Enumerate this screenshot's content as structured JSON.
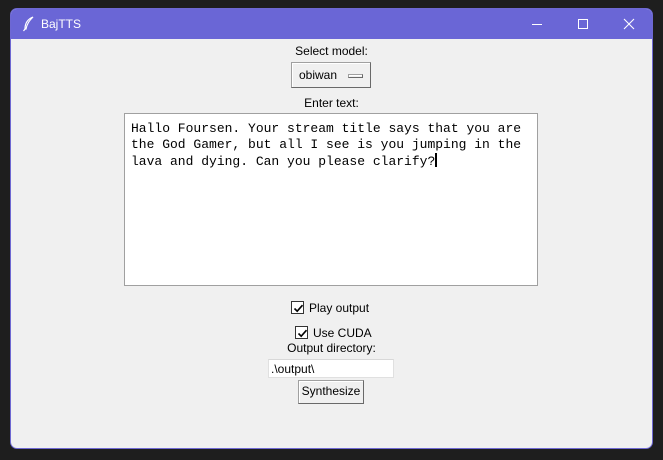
{
  "window": {
    "title": "BajTTS",
    "accent_color": "#6a66d6",
    "icons": {
      "app": "feather-icon",
      "minimize": "minimize-icon",
      "maximize": "maximize-icon",
      "close": "close-icon"
    }
  },
  "model": {
    "label": "Select model:",
    "selected": "obiwan"
  },
  "text_input": {
    "label": "Enter text:",
    "lines": [
      "Hallo Foursen. Your stream title says that you are",
      "the God Gamer, but all I see is you jumping in the",
      "lava and dying. Can you please clarify?"
    ]
  },
  "options": {
    "play_output": {
      "label": "Play output",
      "checked": true
    },
    "use_cuda": {
      "label": "Use CUDA",
      "checked": true
    }
  },
  "output": {
    "label": "Output directory:",
    "value": ".\\output\\"
  },
  "actions": {
    "synthesize_label": "Synthesize"
  }
}
